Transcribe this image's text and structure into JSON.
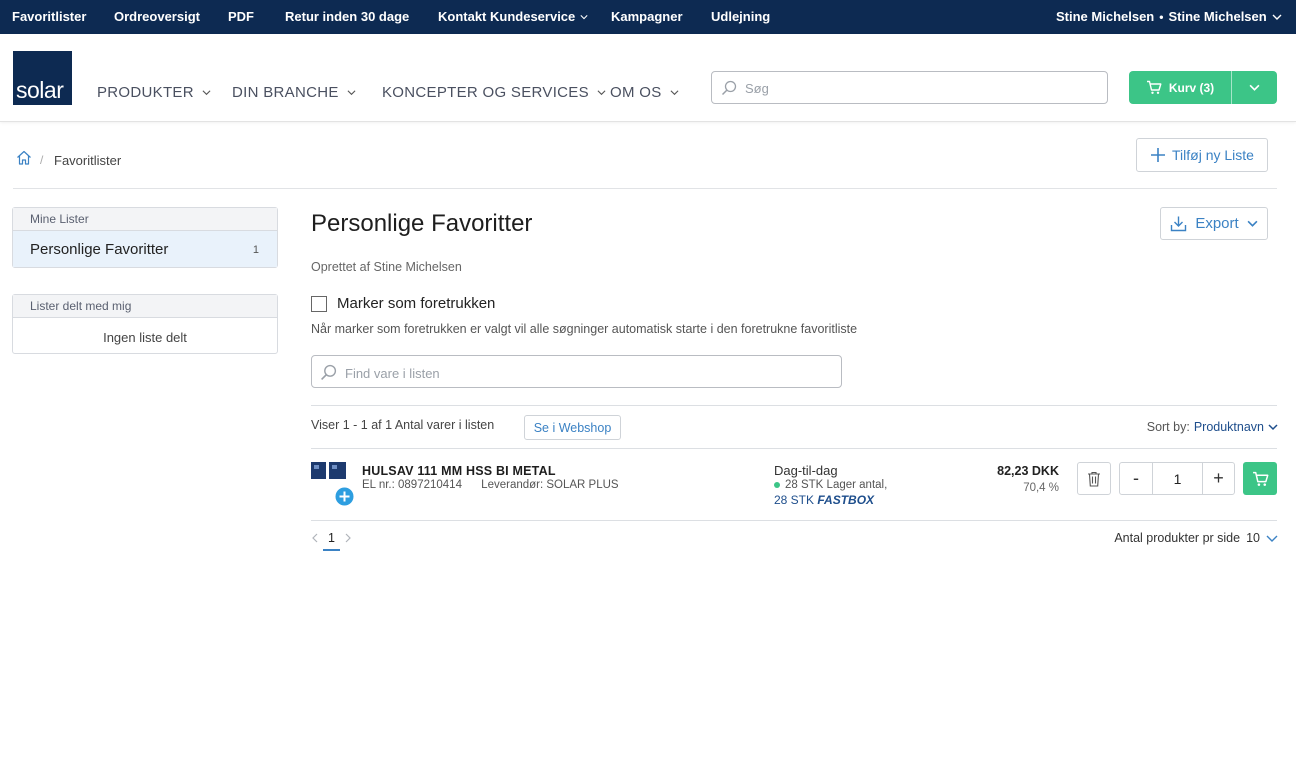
{
  "topbar": {
    "links": [
      "Favoritlister",
      "Ordreoversigt",
      "PDF",
      "Retur inden 30 dage",
      "Kontakt Kundeservice",
      "Kampagner",
      "Udlejning"
    ],
    "user_company": "Stine Michelsen",
    "separator": "•",
    "user_name": "Stine Michelsen"
  },
  "header": {
    "logo_text": "solar",
    "nav": [
      "PRODUKTER",
      "DIN BRANCHE",
      "KONCEPTER OG SERVICES",
      "OM OS"
    ],
    "search_placeholder": "Søg",
    "cart_label": "Kurv (3)"
  },
  "breadcrumb": {
    "separator": "/",
    "current": "Favoritlister"
  },
  "add_list_label": "Tilføj ny Liste",
  "sidebar": {
    "my_lists_header": "Mine Lister",
    "my_lists": [
      {
        "name": "Personlige Favoritter",
        "count": "1"
      }
    ],
    "shared_header": "Lister delt med mig",
    "shared_empty": "Ingen liste delt"
  },
  "main": {
    "title": "Personlige Favoritter",
    "export_label": "Export",
    "created_by": "Oprettet af Stine Michelsen",
    "preferred_label": "Marker som foretrukken",
    "preferred_checked": false,
    "preferred_hint": "Når marker som foretrukken er valgt vil alle søgninger automatisk starte i den foretrukne favoritliste",
    "find_placeholder": "Find vare i listen",
    "showing_text": "Viser 1 - 1 af 1 Antal varer i listen",
    "webshop_label": "Se i Webshop",
    "sort_label": "Sort by:",
    "sort_value": "Produktnavn"
  },
  "products": [
    {
      "name": "HULSAV 111 MM HSS BI METAL",
      "el_nr": "EL nr.: 0897210414",
      "supplier": "Leverandør: SOLAR PLUS",
      "delivery": "Dag-til-dag",
      "stock_line": "28 STK Lager antal,",
      "fastbox_qty": "28 STK",
      "fastbox_label": "FASTBOX",
      "price": "82,23 DKK",
      "discount": "70,4 %",
      "qty_minus": "-",
      "quantity": "1",
      "qty_plus": "+"
    }
  ],
  "pagination": {
    "current_page": "1",
    "per_page_label": "Antal produkter pr side",
    "per_page_value": "10"
  },
  "colors": {
    "topbar_bg": "#0d2a52",
    "accent_green": "#3cc587",
    "link_blue": "#3b82c4",
    "dark_blue_text": "#1e4e8c"
  }
}
